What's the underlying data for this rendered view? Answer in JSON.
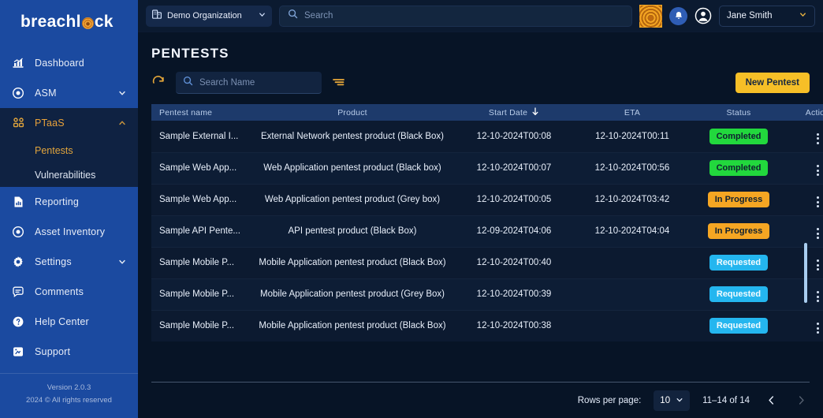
{
  "sidebar": {
    "logo_before": "breachl",
    "logo_after": "ck",
    "items": [
      {
        "label": "Dashboard",
        "icon": "chart-bar-icon",
        "chevron": false
      },
      {
        "label": "ASM",
        "icon": "target-icon",
        "chevron": true
      },
      {
        "label": "PTaaS",
        "icon": "people-group-icon",
        "chevron": true
      },
      {
        "label": "Reporting",
        "icon": "report-file-icon",
        "chevron": false
      },
      {
        "label": "Asset Inventory",
        "icon": "target-icon",
        "chevron": false
      },
      {
        "label": "Settings",
        "icon": "gear-icon",
        "chevron": true
      },
      {
        "label": "Comments",
        "icon": "comment-icon",
        "chevron": false
      },
      {
        "label": "Help Center",
        "icon": "question-circle-icon",
        "chevron": false
      },
      {
        "label": "Support",
        "icon": "support-icon",
        "chevron": false
      }
    ],
    "ptaas_sub": [
      {
        "label": "Pentests",
        "active": true
      },
      {
        "label": "Vulnerabilities",
        "active": false
      }
    ],
    "footer": {
      "version": "Version 2.0.3",
      "copyright": "2024 © All rights reserved"
    },
    "accent": "#e0a43c",
    "bg": "#1b4aa0"
  },
  "topbar": {
    "org_name": "Demo Organization",
    "search_placeholder": "Search",
    "search_value": "",
    "user_name": "Jane Smith",
    "scan_icon": "fingerprint-scan-icon",
    "bell_icon": "notification-bell-icon",
    "avatar_icon": "user-avatar-icon"
  },
  "page": {
    "title": "PENTESTS"
  },
  "toolbar": {
    "refresh_icon": "refresh-icon",
    "search_placeholder": "Search Name",
    "search_value": "",
    "filter_icon": "filter-icon",
    "new_pentest_label": "New Pentest"
  },
  "table": {
    "columns": [
      {
        "label": "Pentest name",
        "align": "left"
      },
      {
        "label": "Product",
        "align": "center"
      },
      {
        "label": "Start Date",
        "align": "center",
        "sorted": "desc"
      },
      {
        "label": "ETA",
        "align": "center"
      },
      {
        "label": "Status",
        "align": "center"
      },
      {
        "label": "Action",
        "align": "center"
      }
    ],
    "rows": [
      {
        "name": "Sample External I...",
        "product": "External Network pentest product (Black Box)",
        "start_date": "12-10-2024T00:08",
        "eta": "12-10-2024T00:11",
        "status": "Completed",
        "status_kind": "completed"
      },
      {
        "name": "Sample Web App...",
        "product": "Web Application pentest product (Black box)",
        "start_date": "12-10-2024T00:07",
        "eta": "12-10-2024T00:56",
        "status": "Completed",
        "status_kind": "completed"
      },
      {
        "name": "Sample Web App...",
        "product": "Web Application pentest product (Grey box)",
        "start_date": "12-10-2024T00:05",
        "eta": "12-10-2024T03:42",
        "status": "In Progress",
        "status_kind": "inprogress"
      },
      {
        "name": "Sample API Pente...",
        "product": "API pentest product (Black Box)",
        "start_date": "12-09-2024T04:06",
        "eta": "12-10-2024T04:04",
        "status": "In Progress",
        "status_kind": "inprogress"
      },
      {
        "name": "Sample Mobile P...",
        "product": "Mobile Application pentest product (Black Box)",
        "start_date": "12-10-2024T00:40",
        "eta": "",
        "status": "Requested",
        "status_kind": "requested"
      },
      {
        "name": "Sample Mobile P...",
        "product": "Mobile Application pentest product (Grey Box)",
        "start_date": "12-10-2024T00:39",
        "eta": "",
        "status": "Requested",
        "status_kind": "requested"
      },
      {
        "name": "Sample Mobile P...",
        "product": "Mobile Application pentest product (Black Box)",
        "start_date": "12-10-2024T00:38",
        "eta": "",
        "status": "Requested",
        "status_kind": "requested"
      }
    ]
  },
  "pagination": {
    "rows_per_page_label": "Rows per page:",
    "rows_per_page_value": "10",
    "range_label": "11–14 of 14",
    "prev_icon": "chevron-left-icon",
    "next_icon": "chevron-right-icon"
  },
  "colors": {
    "brand_blue": "#1b4aa0",
    "accent_gold": "#f6bf27",
    "status_completed": "#22d83d",
    "status_inprogress": "#f5a623",
    "status_requested": "#24b6ef"
  }
}
